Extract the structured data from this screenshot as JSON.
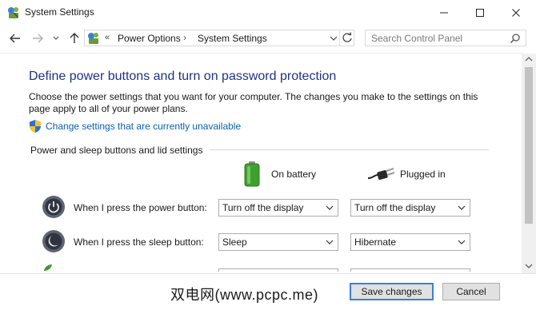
{
  "window": {
    "title": "System Settings",
    "icon": "control-panel-icon"
  },
  "nav": {
    "breadcrumb": [
      "Power Options",
      "System Settings"
    ],
    "breadcrumb_prefix": "«",
    "separator": "›",
    "search_placeholder": "Search Control Panel"
  },
  "content": {
    "heading": "Define power buttons and turn on password protection",
    "description": "Choose the power settings that you want for your computer. The changes you make to the settings on this page apply to all of your power plans.",
    "link": "Change settings that are currently unavailable",
    "group_label": "Power and sleep buttons and lid settings",
    "columns": {
      "battery": "On battery",
      "plugged": "Plugged in"
    },
    "rows": [
      {
        "label": "When I press the power button:",
        "on_battery": "Turn off the display",
        "plugged_in": "Turn off the display",
        "icon": "power-button-icon"
      },
      {
        "label": "When I press the sleep button:",
        "on_battery": "Sleep",
        "plugged_in": "Hibernate",
        "icon": "sleep-button-icon"
      }
    ]
  },
  "footer": {
    "watermark": "双电网(www.pcpc.me)",
    "save": "Save changes",
    "cancel": "Cancel"
  },
  "colors": {
    "heading": "#1e3287",
    "link": "#0a5fb0",
    "default_button_border": "#3c7fd1"
  }
}
